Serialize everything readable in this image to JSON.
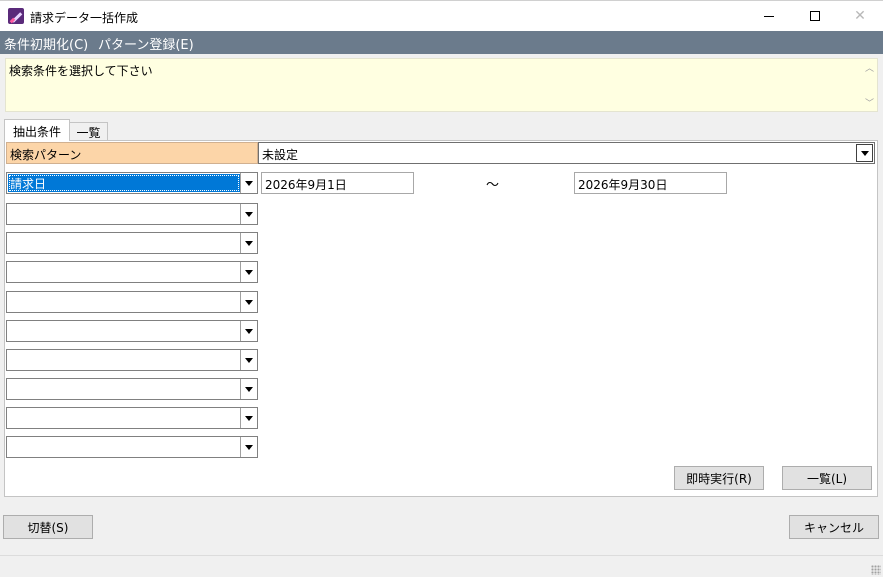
{
  "window": {
    "title": "請求データ一括作成",
    "minimize_glyph": "—",
    "maximize_glyph": "☐",
    "close_glyph": "✕",
    "icon": "app-logo-icon"
  },
  "menu": {
    "items": [
      "条件初期化(C)",
      "パターン登録(E)"
    ]
  },
  "message": {
    "text": "検索条件を選択して下さい"
  },
  "tabs": {
    "active": "抽出条件",
    "inactive": "一覧"
  },
  "search_pattern": {
    "label": "検索パターン",
    "value": "未設定"
  },
  "conditions": {
    "first_field": "請求日",
    "date_from": "2026年9月1日",
    "separator": "〜",
    "date_to": "2026年9月30日",
    "empty_rows": 9
  },
  "buttons": {
    "run": "即時実行(R)",
    "list": "一覧(L)",
    "switch": "切替(S)",
    "cancel": "キャンセル"
  },
  "colors": {
    "menubar": "#6b7b8c",
    "message_bg": "#ffffe1",
    "pattern_label_bg": "#fcd5a8",
    "selection": "#0078d7"
  }
}
